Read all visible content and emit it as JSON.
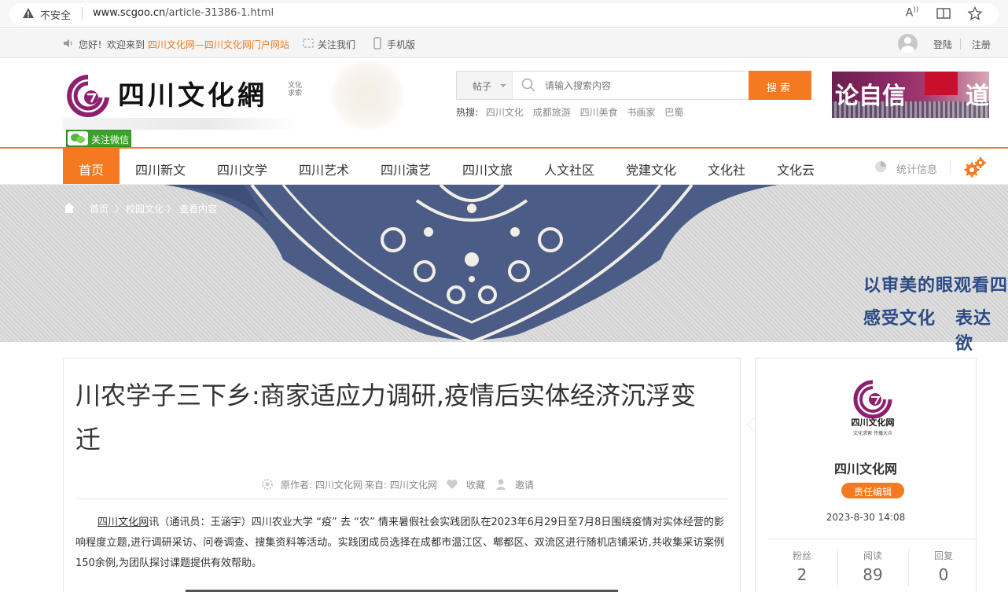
{
  "browser": {
    "insecure_label": "不安全",
    "url_host": "www.scgoo.cn",
    "url_path": "/article-31386-1.html"
  },
  "topbar": {
    "greeting": "您好！欢迎来到",
    "site_link": "四川文化网—四川文化网门户网站",
    "follow": "关注我们",
    "mobile": "手机版",
    "login": "登陆",
    "register": "注册"
  },
  "header": {
    "logo_text": "四川文化網",
    "logo_sub": "文化求索",
    "wechat": "关注微信",
    "search_type": "帖子",
    "search_placeholder": "请输入搜索内容",
    "search_button": "搜索",
    "hot_label": "热搜:",
    "hot_items": [
      "四川文化",
      "成都旅游",
      "四川美食",
      "书画家",
      "巴蜀"
    ],
    "ad_text_left": "论自信",
    "ad_text_right": "道"
  },
  "nav": {
    "items": [
      "首页",
      "四川新文",
      "四川文学",
      "四川艺术",
      "四川演艺",
      "四川文旅",
      "人文社区",
      "党建文化",
      "文化社",
      "文化云"
    ],
    "stats": "统计信息"
  },
  "breadcrumb": {
    "items": [
      "首页",
      "校园文化",
      "查看内容"
    ]
  },
  "banner": {
    "slogan_1": "以审美的眼观看四",
    "slogan_2a": "感受文化",
    "slogan_2b": "表达欲"
  },
  "article": {
    "title": "川农学子三下乡:商家适应力调研,疫情后实体经济沉浮变迁",
    "meta_author": "原作者: 四川文化网",
    "meta_source": "来自: 四川文化网",
    "favorite": "收藏",
    "invite": "邀请",
    "body_source": "四川文化网",
    "body": "讯（通讯员：王涵宇）四川农业大学 “疫” 去 “农” 情来暑假社会实践团队在2023年6月29日至7月8日围绕疫情对实体经营的影响程度立题,进行调研采访、问卷调查、搜集资料等活动。实践团成员选择在成都市温江区、郫都区、双流区进行随机店铺采访,共收集采访案例150余例,为团队探讨课题提供有效帮助。"
  },
  "sidebar": {
    "logo_name": "四川文化网",
    "logo_sub": "文化求索 传播大众",
    "name": "四川文化网",
    "badge": "责任编辑",
    "date": "2023-8-30 14:08",
    "stats": [
      {
        "label": "粉丝",
        "value": "2"
      },
      {
        "label": "阅读",
        "value": "89"
      },
      {
        "label": "回复",
        "value": "0"
      }
    ]
  },
  "colors": {
    "accent": "#f47920",
    "banner_blue": "#2b4a86",
    "wechat_green": "#3aa22b"
  }
}
